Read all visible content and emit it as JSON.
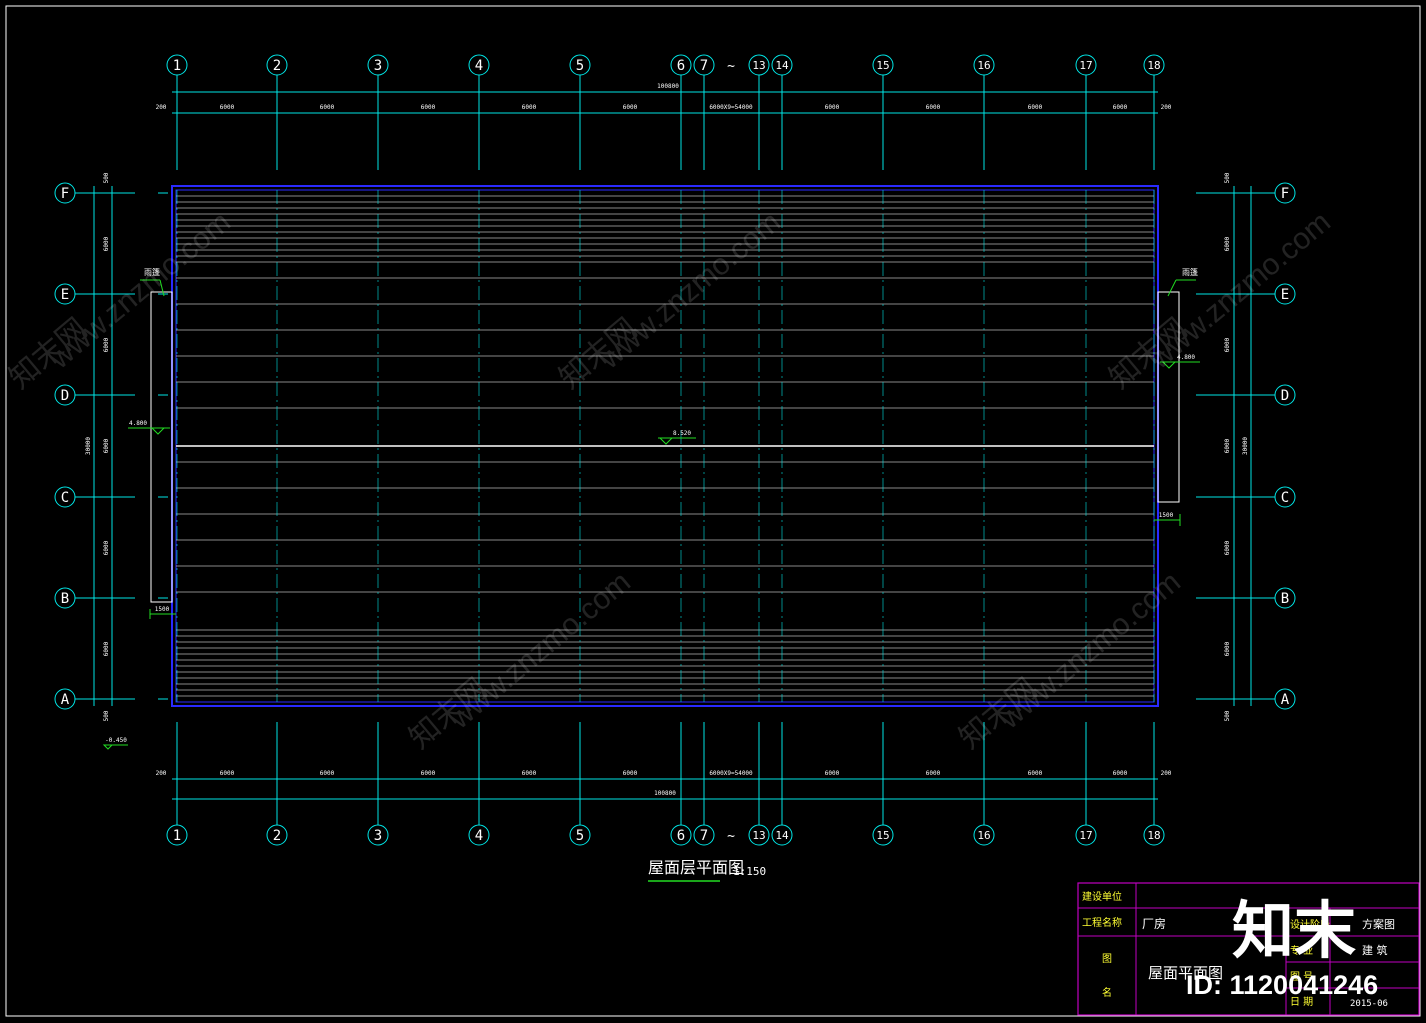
{
  "plan": {
    "title": "屋面层平面图",
    "scale": "1:150"
  },
  "axes": {
    "columns_top": [
      "1",
      "2",
      "3",
      "4",
      "5",
      "6",
      "7",
      "~",
      "13",
      "14",
      "15",
      "16",
      "17",
      "18"
    ],
    "columns_bottom": [
      "1",
      "2",
      "3",
      "4",
      "5",
      "6",
      "7",
      "~",
      "13",
      "14",
      "15",
      "16",
      "17",
      "18"
    ],
    "rows_left": [
      "F",
      "E",
      "D",
      "C",
      "B",
      "A"
    ],
    "rows_right": [
      "F",
      "E",
      "D",
      "C",
      "B",
      "A"
    ]
  },
  "dimensions": {
    "top_total": "100800",
    "bottom_total": "100800",
    "top_segments": [
      "200",
      "6000",
      "6000",
      "6000",
      "6000",
      "6000",
      "6000X9=54000",
      "6000",
      "6000",
      "6000",
      "6000",
      "200"
    ],
    "bottom_segments": [
      "200",
      "6000",
      "6000",
      "6000",
      "6000",
      "6000",
      "6000X9=54000",
      "6000",
      "6000",
      "6000",
      "6000",
      "200"
    ],
    "left_segments": [
      "500",
      "6000",
      "6000",
      "6000",
      "6000",
      "6000",
      "500"
    ],
    "left_total": "30000",
    "right_segments": [
      "500",
      "6000",
      "6000",
      "6000",
      "6000",
      "6000",
      "500"
    ],
    "right_total": "30000"
  },
  "annotations": {
    "left_canopy": "雨篷",
    "right_canopy": "雨篷",
    "left_elev": "4.800",
    "right_elev": "4.800",
    "center_elev": "8.520",
    "left_width": "1500",
    "right_width": "1500",
    "bottom_left_elev": "-0.450"
  },
  "title_block": {
    "client_label": "建设单位",
    "client_value": "",
    "project_label": "工程名称",
    "project_value": "厂房",
    "phase_label": "设计阶段",
    "phase_value": "方案图",
    "drawing_name_label_1": "图",
    "drawing_name_label_2": "名",
    "drawing_name_value": "屋面平面图",
    "discipline_label": "专 业",
    "discipline_value": "建 筑",
    "number_label": "图 号",
    "number_value": "",
    "date_label": "日 期",
    "date_value": "2015-06"
  },
  "watermark": {
    "brand": "知末",
    "id": "ID: 1120041246",
    "text": "www.znzmo.com",
    "cn": "知末网"
  },
  "colors": {
    "axis": "#00e5e5",
    "roof_blue": "#2222ff",
    "roof_lines": "#d8d8d8",
    "green": "#22dd22",
    "yellow": "#ffff33",
    "magenta": "#c000c0",
    "text": "#ffffff"
  }
}
